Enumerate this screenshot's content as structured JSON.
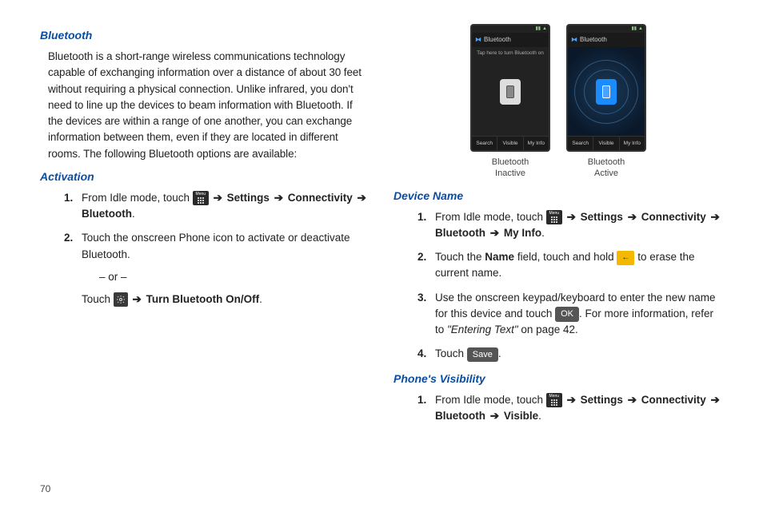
{
  "pageNumber": "70",
  "left": {
    "heading1": "Bluetooth",
    "intro": "Bluetooth is a short-range wireless communications technology capable of exchanging information over a distance of about 30 feet without requiring a physical connection. Unlike infrared, you don't need to line up the devices to beam information with Bluetooth. If the devices are within a range of one another, you can exchange information between them, even if they are located in different rooms. The following Bluetooth options are available:",
    "heading2": "Activation",
    "step1_prefix": "From Idle mode, touch ",
    "step1_settings": "Settings",
    "step1_connectivity": "Connectivity",
    "step1_bluetooth": "Bluetooth",
    "step2": "Touch the onscreen Phone icon to activate or deactivate Bluetooth.",
    "or": "– or –",
    "step2b_prefix": "Touch ",
    "step2b_suffix": "Turn Bluetooth On/Off",
    "menuLabel": "Menu"
  },
  "right": {
    "phones": {
      "bluetoothTitle": "Bluetooth",
      "tapHint": "Tap here to turn Bluetooth on",
      "tabs": [
        "Search",
        "Visible",
        "My Info"
      ],
      "inactiveCaption1": "Bluetooth",
      "inactiveCaption2": "Inactive",
      "activeCaption1": "Bluetooth",
      "activeCaption2": "Active"
    },
    "headingDevice": "Device Name",
    "dev_step1_prefix": "From Idle mode, touch ",
    "dev_step1_settings": "Settings",
    "dev_step1_connectivity": "Connectivity",
    "dev_step1_bluetooth": "Bluetooth",
    "dev_step1_myinfo": "My Info",
    "dev_step2_a": "Touch the ",
    "dev_step2_name": "Name",
    "dev_step2_b": " field, touch and hold ",
    "dev_step2_c": " to erase the current name.",
    "dev_step3_a": "Use the onscreen keypad/keyboard to enter the new name for this device and touch ",
    "dev_step3_ok": "OK",
    "dev_step3_b": ". For more information, refer to ",
    "dev_step3_ref": "\"Entering Text\"",
    "dev_step3_c": " on page 42.",
    "dev_step4_a": "Touch ",
    "dev_step4_save": "Save",
    "dev_step4_b": ".",
    "headingVisibility": "Phone's Visibility",
    "vis_step1_prefix": "From Idle mode, touch ",
    "vis_step1_settings": "Settings",
    "vis_step1_connectivity": "Connectivity",
    "vis_step1_bluetooth": "Bluetooth",
    "vis_step1_visible": "Visible"
  },
  "arrows": {
    "right": "➔"
  }
}
